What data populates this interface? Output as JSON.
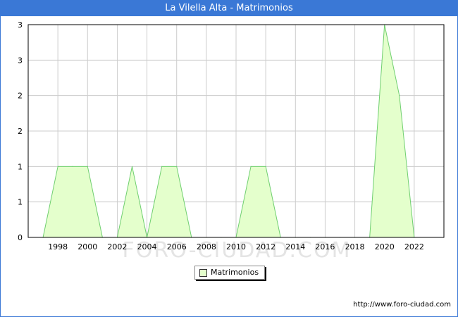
{
  "title": "La Vilella Alta - Matrimonios",
  "watermark": "FORO-CIUDAD.COM",
  "source_url": "http://www.foro-ciudad.com",
  "colors": {
    "header": "#3a78d6",
    "fill": "#e4ffcc",
    "line": "#6fcf6f",
    "grid": "#cccccc"
  },
  "chart_data": {
    "type": "area",
    "title": "La Vilella Alta - Matrimonios",
    "x": [
      1997,
      1998,
      1999,
      2000,
      2001,
      2002,
      2003,
      2004,
      2005,
      2006,
      2007,
      2008,
      2009,
      2010,
      2011,
      2012,
      2013,
      2014,
      2015,
      2016,
      2017,
      2018,
      2019,
      2020,
      2021,
      2022
    ],
    "series": [
      {
        "name": "Matrimonios",
        "values": [
          0,
          1,
          1,
          1,
          0,
          0,
          1,
          0,
          1,
          1,
          0,
          0,
          0,
          0,
          1,
          1,
          0,
          0,
          0,
          0,
          0,
          0,
          0,
          3,
          2,
          0
        ]
      }
    ],
    "ylim": [
      0,
      3
    ],
    "y_tick_values": [
      0,
      0.5,
      1,
      1.5,
      2,
      2.5,
      3
    ],
    "y_tick_labels": [
      "0",
      "1",
      "1",
      "2",
      "2",
      "3",
      "3"
    ],
    "x_tick_labels": [
      "1998",
      "2000",
      "2002",
      "2004",
      "2006",
      "2008",
      "2010",
      "2012",
      "2014",
      "2016",
      "2018",
      "2020",
      "2022"
    ],
    "xlabel": "",
    "ylabel": "",
    "grid": true,
    "legend": "bottom-center"
  }
}
